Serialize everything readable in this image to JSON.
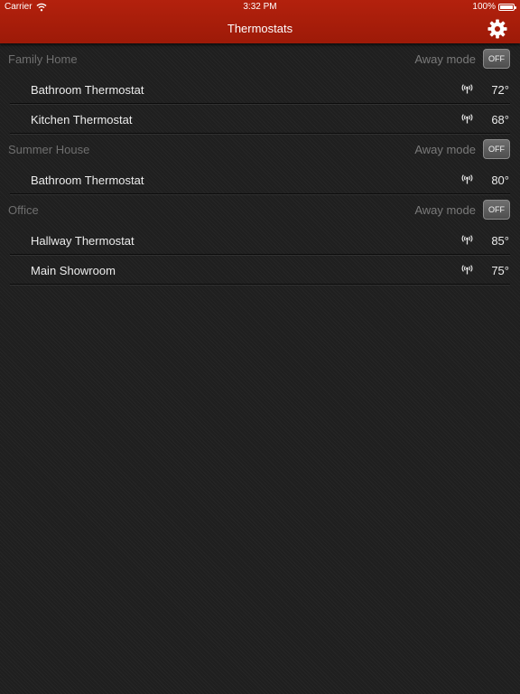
{
  "status_bar": {
    "carrier": "Carrier",
    "time": "3:32 PM",
    "battery": "100%",
    "battery_level": 1.0
  },
  "nav_bar": {
    "title": "Thermostats",
    "settings_icon": "gear-icon",
    "accent_color": "#a81d0a"
  },
  "sections": [
    {
      "title": "Family Home",
      "away_label": "Away mode",
      "away_toggle": "OFF",
      "thermostats": [
        {
          "name": "Bathroom Thermostat",
          "temperature": "72°",
          "icon": "signal-icon"
        },
        {
          "name": "Kitchen Thermostat",
          "temperature": "68°",
          "icon": "signal-icon"
        }
      ]
    },
    {
      "title": "Summer House",
      "away_label": "Away mode",
      "away_toggle": "OFF",
      "thermostats": [
        {
          "name": "Bathroom Thermostat",
          "temperature": "80°",
          "icon": "signal-icon"
        }
      ]
    },
    {
      "title": "Office",
      "away_label": "Away mode",
      "away_toggle": "OFF",
      "thermostats": [
        {
          "name": "Hallway Thermostat",
          "temperature": "85°",
          "icon": "signal-icon"
        },
        {
          "name": "Main Showroom",
          "temperature": "75°",
          "icon": "signal-icon"
        }
      ]
    }
  ]
}
